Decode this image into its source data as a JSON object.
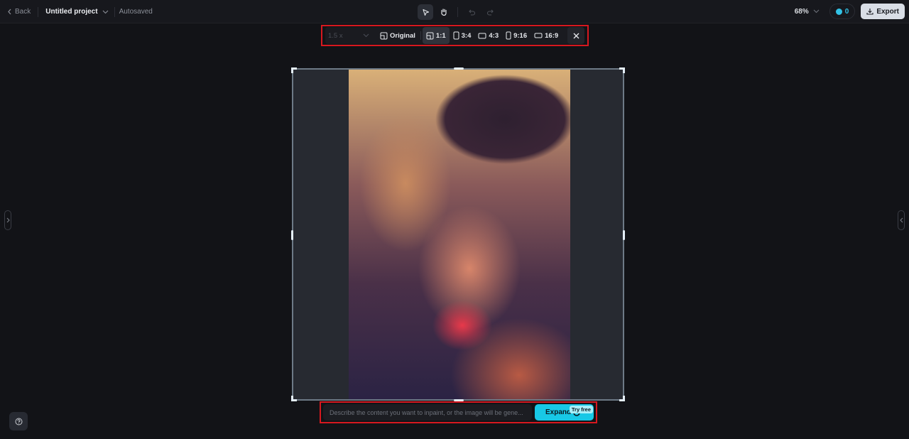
{
  "header": {
    "back_label": "Back",
    "project_title": "Untitled project",
    "save_status": "Autosaved",
    "zoom_level": "68%",
    "credits": "0",
    "export_label": "Export"
  },
  "ratio_toolbar": {
    "scale_value": "1.5 x",
    "options": [
      {
        "label": "Original",
        "icon": "original-ratio-icon",
        "active": false
      },
      {
        "label": "1:1",
        "icon": "square-ratio-icon",
        "active": true
      },
      {
        "label": "3:4",
        "icon": "portrait-ratio-icon",
        "active": false
      },
      {
        "label": "4:3",
        "icon": "landscape-ratio-icon",
        "active": false
      },
      {
        "label": "9:16",
        "icon": "tall-ratio-icon",
        "active": false
      },
      {
        "label": "16:9",
        "icon": "wide-ratio-icon",
        "active": false
      }
    ]
  },
  "canvas": {
    "image_description": "Smiling woman with wavy hair wearing a dark hat, warm glitter-toned photo"
  },
  "prompt": {
    "placeholder": "Describe the content you want to inpaint, or the image will be gene...",
    "expand_label": "Expand",
    "badge": "Try free"
  },
  "colors": {
    "accent": "#18c8e6",
    "highlight_border": "#d7181f",
    "background": "#121317"
  }
}
